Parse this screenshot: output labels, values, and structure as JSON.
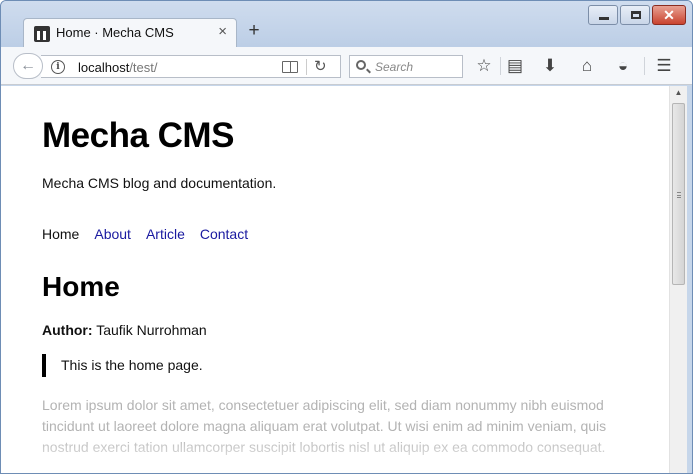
{
  "browser": {
    "tab": {
      "title": "Home · Mecha CMS",
      "close_glyph": "×",
      "favicon": "mecha-favicon"
    },
    "new_tab_glyph": "+",
    "url": {
      "host": "localhost",
      "path": "/test/"
    },
    "search_placeholder": "Search",
    "icons": {
      "back": "←",
      "reload": "↻",
      "bookmark_star": "☆",
      "bookmarks_list": "▤",
      "downloads": "⬇",
      "home": "⌂",
      "pocket": "◒",
      "menu": "☰",
      "window_close": "✕"
    }
  },
  "page": {
    "site_title": "Mecha CMS",
    "site_description": "Mecha CMS blog and documentation.",
    "nav": [
      "Home",
      "About",
      "Article",
      "Contact"
    ],
    "heading": "Home",
    "author_label": "Author:",
    "author_name": "Taufik Nurrohman",
    "quote": "This is the home page.",
    "body": "Lorem ipsum dolor sit amet, consectetuer adipiscing elit, sed diam nonummy nibh euismod tincidunt ut laoreet dolore magna aliquam erat volutpat. Ut wisi enim ad minim veniam, quis nostrud exerci tation ullamcorper suscipit lobortis nisl ut aliquip ex ea commodo consequat."
  }
}
